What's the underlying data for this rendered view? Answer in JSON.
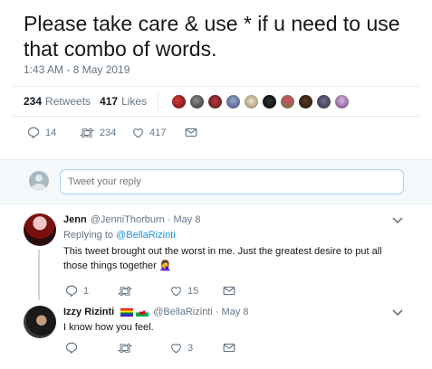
{
  "tweet": {
    "text": "Please take care & use * if u need to use that combo of words.",
    "timestamp": "1:43 AM - 8 May 2019",
    "retweets_count": "234",
    "retweets_label": "Retweets",
    "likes_count": "417",
    "likes_label": "Likes",
    "actions": {
      "reply_count": "14",
      "retweet_count": "234",
      "like_count": "417"
    }
  },
  "reply_box": {
    "placeholder": "Tweet your reply"
  },
  "replies": [
    {
      "name": "Jenn",
      "handle": "@JenniThorburn",
      "date": "· May 8",
      "replying_to_label": "Replying to",
      "replying_to_handle": "@BellaRizinti",
      "text": "This tweet brought out the worst in me. Just the greatest desire to put all those things together 🤦‍♀️",
      "reply_count": "1",
      "retweet_count": "",
      "like_count": "15"
    },
    {
      "name": "Izzy Rizinti",
      "handle": "@BellaRizinti",
      "date": "· May 8",
      "text": "I know how you feel.",
      "reply_count": "",
      "retweet_count": "",
      "like_count": "3"
    }
  ],
  "colors": {
    "accent": "#1b95e0",
    "secondary_text": "#657786",
    "border": "#e6ecf0"
  }
}
